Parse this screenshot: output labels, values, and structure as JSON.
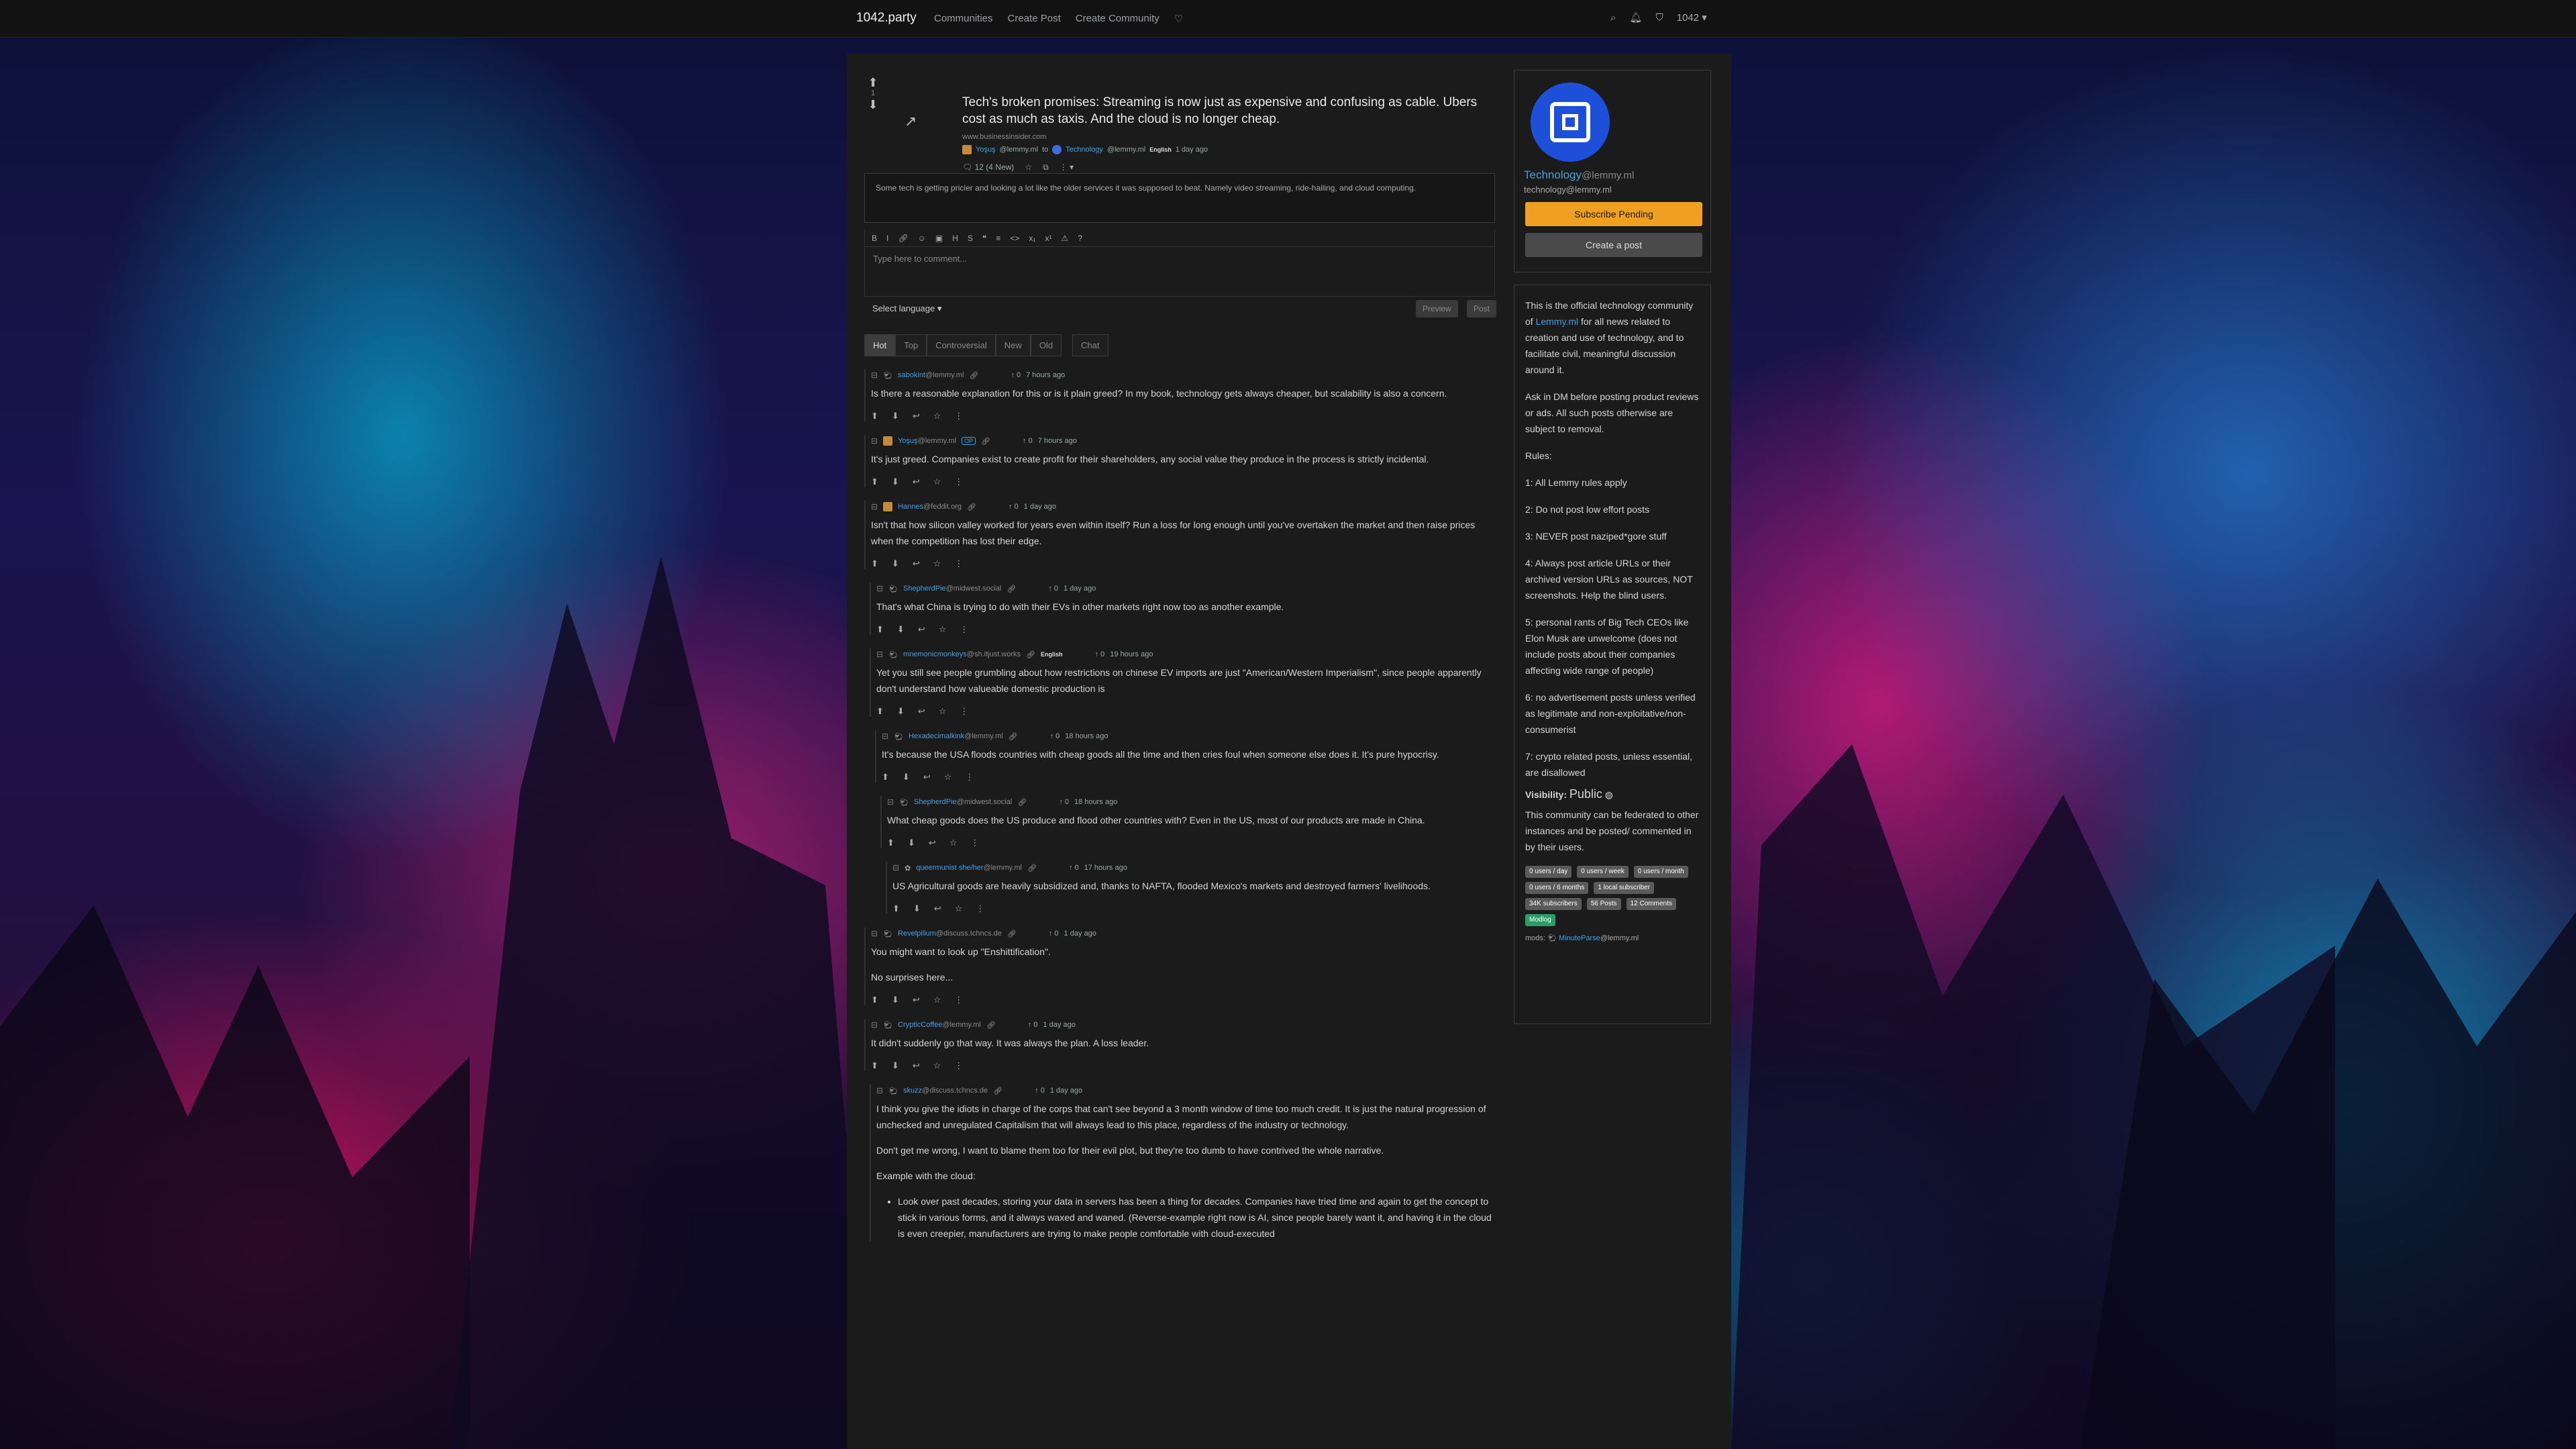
{
  "nav": {
    "brand": "1042.party",
    "links": [
      "Communities",
      "Create Post",
      "Create Community"
    ],
    "user": "1042"
  },
  "post": {
    "score": "1",
    "title": "Tech's broken promises: Streaming is now just as expensive and confusing as cable. Ubers cost as much as taxis. And the cloud is no longer cheap.",
    "url": "www.businessinsider.com",
    "author": "Yoşuş",
    "author_instance": "@lemmy.ml",
    "to": "to",
    "community": "Technology",
    "community_instance": "@lemmy.ml",
    "language": "English",
    "time": "1 day ago",
    "comments_count": "12",
    "comments_new": "(4 New)",
    "body": "Some tech is getting pricier and looking a lot like the older services it was supposed to beat. Namely video streaming, ride-hailing, and cloud computing."
  },
  "editor": {
    "placeholder": "Type here to comment...",
    "language_select": "Select language",
    "preview": "Preview",
    "post": "Post"
  },
  "sort_tabs": [
    "Hot",
    "Top",
    "Controversial",
    "New",
    "Old"
  ],
  "chat_tab": "Chat",
  "comments": [
    {
      "user": "sabokint",
      "inst": "@lemmy.ml",
      "score": "0",
      "time": "7 hours ago",
      "text": [
        "Is there a reasonable explanation for this or is it plain greed? In my book, technology gets always cheaper, but scalability is also a concern."
      ]
    },
    {
      "user": "Yoşuş",
      "inst": "@lemmy.ml",
      "op": "OP",
      "score": "0",
      "time": "7 hours ago",
      "text": [
        "It's just greed. Companies exist to create profit for their shareholders, any social value they produce in the process is strictly incidental."
      ]
    },
    {
      "user": "Hannes",
      "inst": "@feddit.org",
      "score": "0",
      "time": "1 day ago",
      "text": [
        "Isn't that how silicon valley worked for years even within itself? Run a loss for long enough until you've overtaken the market and then raise prices when the competition has lost their edge."
      ]
    },
    {
      "user": "ShepherdPie",
      "inst": "@midwest.social",
      "score": "0",
      "time": "1 day ago",
      "text": [
        "That's what China is trying to do with their EVs in other markets right now too as another example."
      ]
    },
    {
      "user": "mnemonicmonkeys",
      "inst": "@sh.itjust.works",
      "lang": "English",
      "score": "0",
      "time": "19 hours ago",
      "text": [
        "Yet you still see people grumbling about how restrictions on chinese EV imports are just \"American/Western Imperialism\", since people apparently don't understand how valueable domestic production is"
      ]
    },
    {
      "user": "Hexadecimalkink",
      "inst": "@lemmy.ml",
      "score": "0",
      "time": "18 hours ago",
      "text": [
        "It's because the USA floods countries with cheap goods all the time and then cries foul when someone else does it. It's pure hypocrisy."
      ]
    },
    {
      "user": "ShepherdPie",
      "inst": "@midwest.social",
      "score": "0",
      "time": "18 hours ago",
      "text": [
        "What cheap goods does the US produce and flood other countries with? Even in the US, most of our products are made in China."
      ]
    },
    {
      "user": "queermunist she/her",
      "inst": "@lemmy.ml",
      "score": "0",
      "time": "17 hours ago",
      "text": [
        "US Agricultural goods are heavily subsidized and, thanks to NAFTA, flooded Mexico's markets and destroyed farmers' livelihoods."
      ]
    },
    {
      "user": "Revelpilium",
      "inst": "@discuss.tchncs.de",
      "score": "0",
      "time": "1 day ago",
      "text": [
        "You might want to look up \"Enshittification\".",
        "No surprises here..."
      ]
    },
    {
      "user": "CrypticCoffee",
      "inst": "@lemmy.ml",
      "score": "0",
      "time": "1 day ago",
      "text": [
        "It didn't suddenly go that way. It was always the plan. A loss leader."
      ]
    },
    {
      "user": "skuzz",
      "inst": "@discuss.tchncs.de",
      "score": "0",
      "time": "1 day ago",
      "text": [
        "I think you give the idiots in charge of the corps that can't see beyond a 3 month window of time too much credit. It is just the natural progression of unchecked and unregulated Capitalism that will always lead to this place, regardless of the industry or technology.",
        "Don't get me wrong, I want to blame them too for their evil plot, but they're too dumb to have contrived the whole narrative.",
        "Example with the cloud:"
      ],
      "bullet": "Look over past decades, storing your data in servers has been a thing for decades. Companies have tried time and again to get the concept to stick in various forms, and it always waxed and waned. (Reverse-example right now is AI, since people barely want it, and having it in the cloud is even creepier, manufacturers are trying to make people comfortable with cloud-executed"
    }
  ],
  "sidebar": {
    "community_name": "Technology",
    "community_instance": "@lemmy.ml",
    "handle": "technology@lemmy.ml",
    "subscribe": "Subscribe Pending",
    "create_post": "Create a post",
    "description_pre": "This is the official technology community of ",
    "description_link": "Lemmy.ml",
    "description_post": " for all news related to creation and use of technology, and to facilitate civil, meaningful discussion around it.",
    "ask_dm": "Ask in DM before posting product reviews or ads. All such posts otherwise are subject to removal.",
    "rules_title": "Rules:",
    "rules": [
      "1: All Lemmy rules apply",
      "2: Do not post low effort posts",
      "3: NEVER post naziped*gore stuff",
      "4: Always post article URLs or their archived version URLs as sources, NOT screenshots. Help the blind users.",
      "5: personal rants of Big Tech CEOs like Elon Musk are unwelcome (does not include posts about their companies affecting wide range of people)",
      "6: no advertisement posts unless verified as legitimate and non-exploitative/non-consumerist",
      "7: crypto related posts, unless essential, are disallowed"
    ],
    "visibility_label": "Visibility:",
    "visibility_value": "Public",
    "federation": "This community can be federated to other instances and be posted/ commented in by their users.",
    "stats": [
      "0 users / day",
      "0 users / week",
      "0 users / month",
      "0 users / 6 months",
      "1 local subscriber",
      "34K subscribers",
      "56 Posts",
      "12 Comments",
      "Modlog"
    ],
    "mods_label": "mods:",
    "mod_user": "MinuteParse",
    "mod_inst": "@lemmy.ml"
  }
}
